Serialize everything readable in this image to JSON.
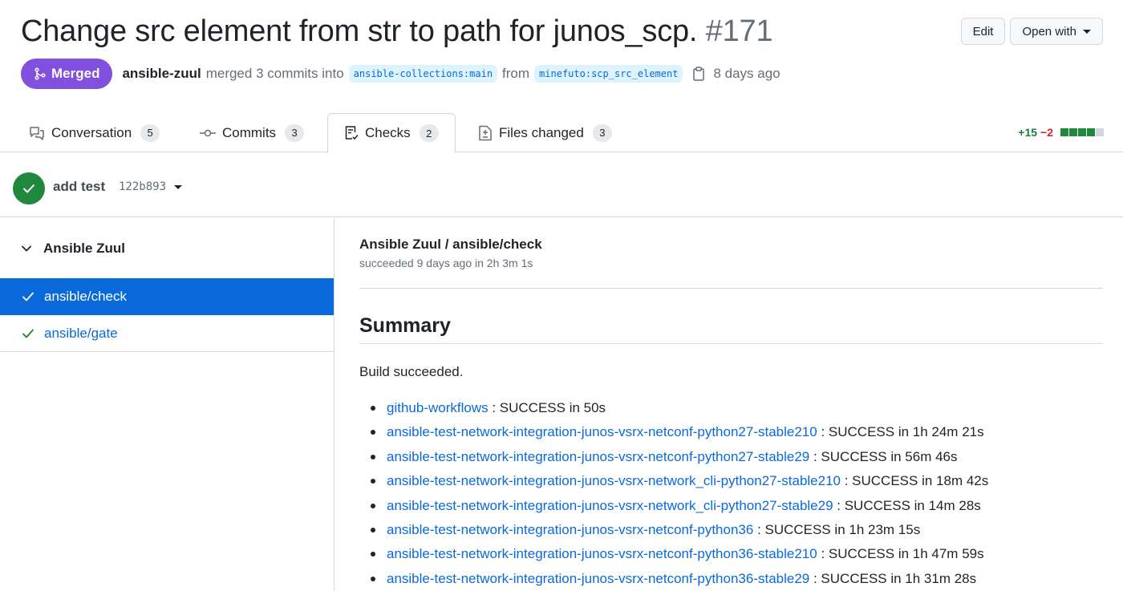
{
  "pr": {
    "title": "Change src element from str to path for junos_scp.",
    "number": "#171",
    "state": "Merged",
    "author": "ansible-zuul",
    "merged_text": "merged 3 commits into",
    "base_branch": "ansible-collections:main",
    "from_text": "from",
    "head_branch": "minefuto:scp_src_element",
    "time": "8 days ago"
  },
  "header_actions": {
    "edit_label": "Edit",
    "open_with_label": "Open with"
  },
  "tabs": [
    {
      "label": "Conversation",
      "count": "5",
      "icon": "comment-discussion-icon"
    },
    {
      "label": "Commits",
      "count": "3",
      "icon": "git-commit-icon"
    },
    {
      "label": "Checks",
      "count": "2",
      "icon": "checklist-icon",
      "active": true
    },
    {
      "label": "Files changed",
      "count": "3",
      "icon": "file-diff-icon"
    }
  ],
  "diffstat": {
    "additions": "+15",
    "deletions": "−2",
    "blocks": [
      "green",
      "green",
      "green",
      "green",
      "gray"
    ]
  },
  "commit": {
    "message": "add test",
    "sha": "122b893",
    "status": "success"
  },
  "sidebar": {
    "suite": "Ansible Zuul",
    "runs": [
      {
        "name": "ansible/check",
        "active": true
      },
      {
        "name": "ansible/gate",
        "active": false
      }
    ]
  },
  "check_run": {
    "title": "Ansible Zuul / ansible/check",
    "status": "succeeded 9 days ago in 2h 3m 1s",
    "summary_heading": "Summary",
    "build_result": "Build succeeded.",
    "jobs": [
      {
        "name": "github-workflows",
        "result": " : SUCCESS in 50s"
      },
      {
        "name": "ansible-test-network-integration-junos-vsrx-netconf-python27-stable210",
        "result": " : SUCCESS in 1h 24m 21s"
      },
      {
        "name": "ansible-test-network-integration-junos-vsrx-netconf-python27-stable29",
        "result": " : SUCCESS in 56m 46s"
      },
      {
        "name": "ansible-test-network-integration-junos-vsrx-network_cli-python27-stable210",
        "result": " : SUCCESS in 18m 42s"
      },
      {
        "name": "ansible-test-network-integration-junos-vsrx-network_cli-python27-stable29",
        "result": " : SUCCESS in 14m 28s"
      },
      {
        "name": "ansible-test-network-integration-junos-vsrx-netconf-python36",
        "result": " : SUCCESS in 1h 23m 15s"
      },
      {
        "name": "ansible-test-network-integration-junos-vsrx-netconf-python36-stable210",
        "result": " : SUCCESS in 1h 47m 59s"
      },
      {
        "name": "ansible-test-network-integration-junos-vsrx-netconf-python36-stable29",
        "result": " : SUCCESS in 1h 31m 28s"
      }
    ]
  },
  "colors": {
    "merged": "#8250df",
    "success": "#1f883d",
    "link": "#0969da",
    "add": "#1a7f37",
    "del": "#cf222e"
  }
}
